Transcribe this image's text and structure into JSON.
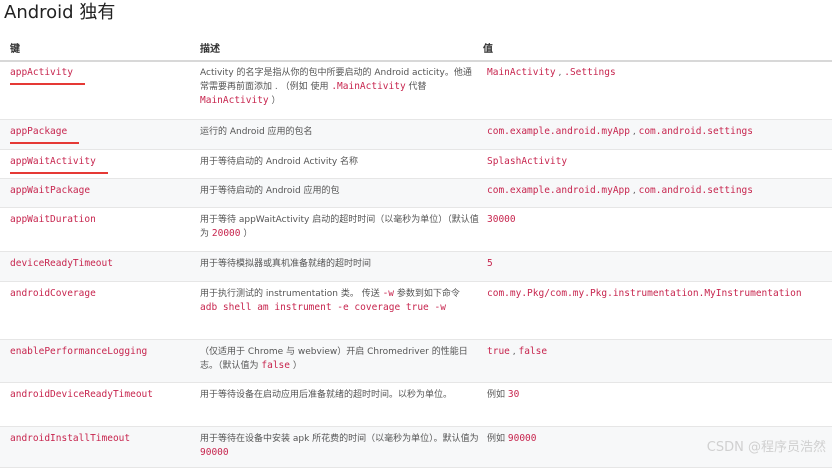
{
  "title": "Android 独有",
  "headers": {
    "key": "键",
    "desc": "描述",
    "value": "值"
  },
  "rows": [
    {
      "key": "appActivity",
      "desc": [
        {
          "t": "Activity 的名字是指从你的包中所要启动的 Android acticity。他通常需要再前面添加 . （例如 使用 "
        },
        {
          "c": ".MainActivity"
        },
        {
          "t": " 代替 "
        },
        {
          "c": "MainActivity"
        },
        {
          "t": " ）"
        }
      ],
      "value": [
        {
          "c": "MainActivity"
        },
        {
          "t": " , "
        },
        {
          "c": ".Settings"
        }
      ]
    },
    {
      "key": "appPackage",
      "desc": [
        {
          "t": "运行的 Android 应用的包名"
        }
      ],
      "value": [
        {
          "c": "com.example.android.myApp"
        },
        {
          "t": " , "
        },
        {
          "c": "com.android.settings"
        }
      ]
    },
    {
      "key": "appWaitActivity",
      "desc": [
        {
          "t": "用于等待启动的 Android Activity 名称"
        }
      ],
      "value": [
        {
          "c": "SplashActivity"
        }
      ]
    },
    {
      "key": "appWaitPackage",
      "desc": [
        {
          "t": "用于等待启动的 Android 应用的包"
        }
      ],
      "value": [
        {
          "c": "com.example.android.myApp"
        },
        {
          "t": " , "
        },
        {
          "c": "com.android.settings"
        }
      ]
    },
    {
      "key": "appWaitDuration",
      "desc": [
        {
          "t": "用于等待 appWaitActivity 启动的超时时间（以毫秒为单位）（默认值为 "
        },
        {
          "c": "20000"
        },
        {
          "t": " ）"
        }
      ],
      "value": [
        {
          "c": "30000"
        }
      ]
    },
    {
      "key": "deviceReadyTimeout",
      "desc": [
        {
          "t": "用于等待模拟器或真机准备就绪的超时时间"
        }
      ],
      "value": [
        {
          "c": "5"
        }
      ]
    },
    {
      "key": "androidCoverage",
      "desc": [
        {
          "t": "用于执行测试的 instrumentation 类。 传送 "
        },
        {
          "c": "-w"
        },
        {
          "t": " 参数到如下命令 "
        },
        {
          "c": "adb shell am instrument -e coverage true -w"
        }
      ],
      "value": [
        {
          "c": "com.my.Pkg/com.my.Pkg.instrumentation.MyInstrumentation"
        }
      ]
    },
    {
      "key": "enablePerformanceLogging",
      "desc": [
        {
          "t": "（仅适用于 Chrome 与 webview）开启 Chromedriver 的性能日志。（默认值为 "
        },
        {
          "c": "false"
        },
        {
          "t": " ）"
        }
      ],
      "value": [
        {
          "c": "true"
        },
        {
          "t": " , "
        },
        {
          "c": "false"
        }
      ]
    },
    {
      "key": "androidDeviceReadyTimeout",
      "desc": [
        {
          "t": "用于等待设备在启动应用后准备就绪的超时时间。以秒为单位。"
        }
      ],
      "value": [
        {
          "t": "例如 "
        },
        {
          "c": "30"
        }
      ]
    },
    {
      "key": "androidInstallTimeout",
      "desc": [
        {
          "t": "用于等待在设备中安装 apk 所花费的时间（以毫秒为单位）。默认值为 "
        },
        {
          "c": "90000"
        }
      ],
      "value": [
        {
          "t": "例如 "
        },
        {
          "c": "90000"
        }
      ]
    }
  ],
  "underlined_keys": [
    "appActivity",
    "appPackage",
    "appWaitActivity"
  ],
  "watermark": "CSDN @程序员浩然",
  "colors": {
    "code": "#c7254e",
    "underline": "#e53935",
    "zebra": "#f7f8f9"
  }
}
